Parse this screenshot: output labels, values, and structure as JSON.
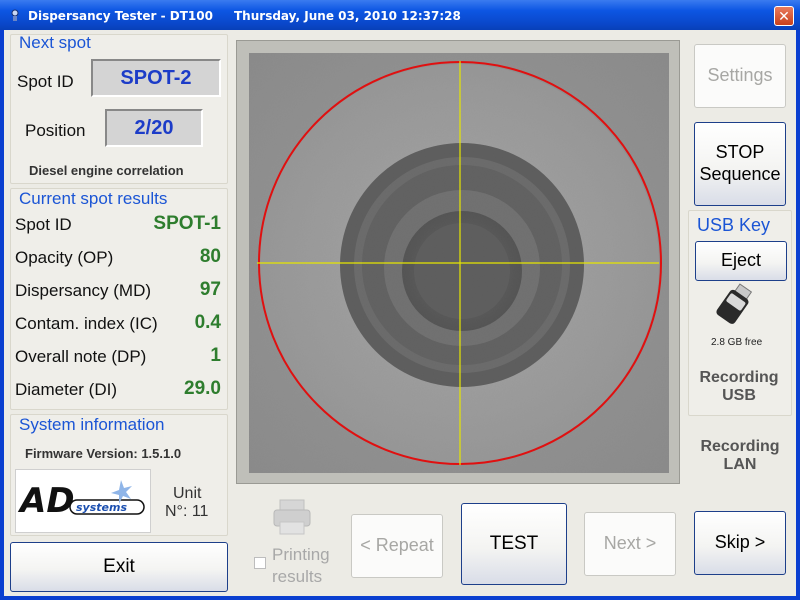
{
  "window": {
    "title": "Dispersancy Tester - DT100",
    "datetime": "Thursday, June 03, 2010    12:37:28"
  },
  "next_spot": {
    "heading": "Next spot",
    "spot_id_label": "Spot ID",
    "spot_id_value": "SPOT-2",
    "position_label": "Position",
    "position_value": "2/20",
    "correlation": "Diesel engine correlation"
  },
  "current_results": {
    "heading": "Current spot results",
    "rows": [
      {
        "label": "Spot ID",
        "value": "SPOT-1"
      },
      {
        "label": "Opacity (OP)",
        "value": "80"
      },
      {
        "label": "Dispersancy (MD)",
        "value": "97"
      },
      {
        "label": "Contam. index (IC)",
        "value": "0.4"
      },
      {
        "label": "Overall note (DP)",
        "value": "1"
      },
      {
        "label": "Diameter (DI)",
        "value": "29.0"
      }
    ]
  },
  "system_info": {
    "heading": "System information",
    "firmware": "Firmware Version: 1.5.1.0",
    "logo_text": "AD systems",
    "unit_line1": "Unit",
    "unit_line2": "N°: 11"
  },
  "buttons": {
    "exit": "Exit",
    "printing_line1": "Printing",
    "printing_line2": "results",
    "repeat": "< Repeat",
    "test": "TEST",
    "next": "Next >",
    "skip": "Skip >",
    "settings": "Settings",
    "stop_line1": "STOP",
    "stop_line2": "Sequence",
    "eject": "Eject"
  },
  "usb": {
    "heading": "USB Key",
    "free_space": "2.8 GB free",
    "recording_usb_line1": "Recording",
    "recording_usb_line2": "USB",
    "recording_lan_line1": "Recording",
    "recording_lan_line2": "LAN"
  },
  "colors": {
    "accent_blue": "#1b55d5",
    "value_green": "#2e7d2e",
    "crosshair": "#e6e600",
    "circle": "#e01010"
  },
  "icons": {
    "app": "dispersancy-app-icon",
    "close": "close-icon",
    "printer": "printer-icon",
    "usb": "usb-stick-icon"
  }
}
